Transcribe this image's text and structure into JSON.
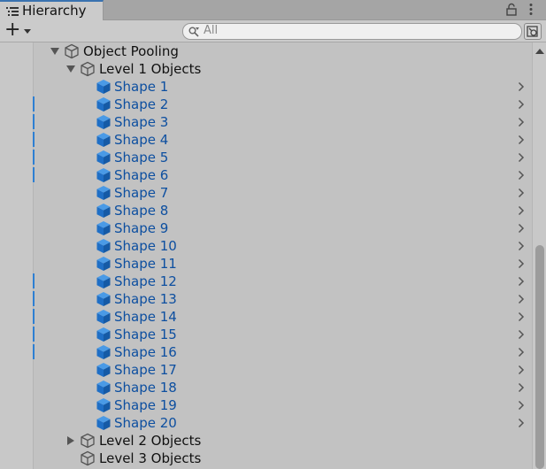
{
  "window": {
    "tab_label": "Hierarchy",
    "icons": {
      "tab": "list-icon",
      "lock": "lock-icon",
      "menu": "kebab-menu-icon"
    }
  },
  "toolbar": {
    "add_label": "+",
    "search_placeholder": "All",
    "icons": {
      "search": "search-icon",
      "mode": "search-mode-icon"
    }
  },
  "colors": {
    "selection_marker": "#2e7fd2",
    "shape_text": "#0d4fa0",
    "cube_prefab": "#1f6fc6",
    "tab_accent": "#3a72b0"
  },
  "tree": {
    "root": {
      "label": "Object Pooling",
      "expanded": true
    },
    "group1": {
      "label": "Level 1 Objects",
      "expanded": true
    },
    "shapes": [
      {
        "label": "Shape 1",
        "marked": false
      },
      {
        "label": "Shape 2",
        "marked": true
      },
      {
        "label": "Shape 3",
        "marked": true
      },
      {
        "label": "Shape 4",
        "marked": true
      },
      {
        "label": "Shape 5",
        "marked": true
      },
      {
        "label": "Shape 6",
        "marked": true
      },
      {
        "label": "Shape 7",
        "marked": false
      },
      {
        "label": "Shape 8",
        "marked": false
      },
      {
        "label": "Shape 9",
        "marked": false
      },
      {
        "label": "Shape 10",
        "marked": false
      },
      {
        "label": "Shape 11",
        "marked": false
      },
      {
        "label": "Shape 12",
        "marked": true
      },
      {
        "label": "Shape 13",
        "marked": true
      },
      {
        "label": "Shape 14",
        "marked": true
      },
      {
        "label": "Shape 15",
        "marked": true
      },
      {
        "label": "Shape 16",
        "marked": true
      },
      {
        "label": "Shape 17",
        "marked": false
      },
      {
        "label": "Shape 18",
        "marked": false
      },
      {
        "label": "Shape 19",
        "marked": false
      },
      {
        "label": "Shape 20",
        "marked": false
      }
    ],
    "group2": {
      "label": "Level 2 Objects",
      "expanded": false
    },
    "group3": {
      "label": "Level 3 Objects",
      "expanded": false
    }
  }
}
